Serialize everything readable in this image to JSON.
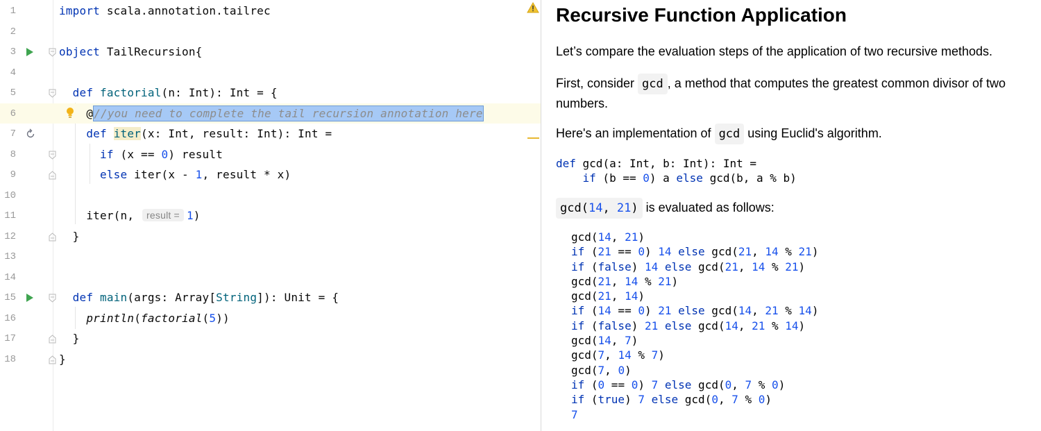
{
  "editor": {
    "line_numbers": [
      "1",
      "2",
      "3",
      "4",
      "5",
      "6",
      "7",
      "8",
      "9",
      "10",
      "11",
      "12",
      "13",
      "14",
      "15",
      "16",
      "17",
      "18"
    ],
    "l1": {
      "kw": "import",
      "rest": " scala.annotation.tailrec"
    },
    "l3": {
      "kw": "object",
      "name": " TailRecursion{"
    },
    "l5": {
      "kw": "def",
      "fn": " factorial",
      "rest": "(n: Int): Int = {"
    },
    "l6": {
      "at": "@",
      "comment": "//you need to complete the tail recursion annotation here"
    },
    "l7": {
      "kw": "def",
      "fn": "iter",
      "rest": "(x: Int, result: Int): Int ="
    },
    "l8": {
      "kw": "if",
      "p1": " (x == ",
      "n": "0",
      "p2": ") result"
    },
    "l9": {
      "kw": "else",
      "p1": " iter(x - ",
      "n": "1",
      "p2": ", result * x)"
    },
    "l11": {
      "p1": "iter(n,",
      "hint": "result =",
      "n": "1",
      "p2": ")"
    },
    "l12": "}",
    "l15": {
      "kw": "def",
      "fn": " main",
      "p1": "(args: Array[",
      "type": "String",
      "p2": "]): Unit = {"
    },
    "l16": {
      "fn": "println",
      "p1": "(",
      "inner": "factorial",
      "p2": "(",
      "n": "5",
      "p3": "))"
    },
    "l17": "}",
    "l18": "}"
  },
  "description": {
    "title": "Recursive Function Application",
    "p1": "Let’s compare the evaluation steps of the application of two recursive methods.",
    "p2_pre": "First, consider ",
    "p2_code": "gcd",
    "p2_post": ", a method that computes the greatest common divisor of two numbers.",
    "p3_pre": "Here's an implementation of ",
    "p3_code": "gcd",
    "p3_post": " using Euclid's algorithm.",
    "def_line1": {
      "kw": "def",
      "rest": " gcd(a: Int, b: Int): Int ="
    },
    "def_line2": {
      "kw1": "if",
      "p1": " (b == ",
      "n": "0",
      "p2": ") a ",
      "kw2": "else",
      "p3": " gcd(b, a % b)"
    },
    "p4_code_pre": "gcd(",
    "p4_n1": "14",
    "p4_mid": ", ",
    "p4_n2": "21",
    "p4_code_post": ")",
    "p4_post": " is evaluated as follows:",
    "eval_lines": [
      "gcd(14, 21)",
      "if (21 == 0) 14 else gcd(21, 14 % 21)",
      "if (false) 14 else gcd(21, 14 % 21)",
      "gcd(21, 14 % 21)",
      "gcd(21, 14)",
      "if (14 == 0) 21 else gcd(14, 21 % 14)",
      "if (false) 21 else gcd(14, 21 % 14)",
      "gcd(14, 7)",
      "gcd(7, 14 % 7)",
      "gcd(7, 0)",
      "if (0 == 0) 7 else gcd(0, 7 % 0)",
      "if (true) 7 else gcd(0, 7 % 0)",
      "7"
    ]
  }
}
